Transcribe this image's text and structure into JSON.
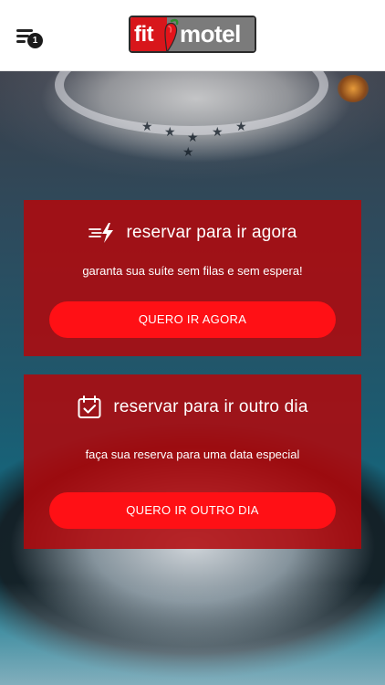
{
  "header": {
    "menu_badge_count": "1",
    "logo": {
      "left_text": "fit",
      "right_text": "motel"
    }
  },
  "cards": [
    {
      "icon": "fast-lightning-icon",
      "title": "reservar para ir agora",
      "subtitle": "garanta sua suíte sem filas e sem espera!",
      "button_label": "QUERO IR AGORA"
    },
    {
      "icon": "calendar-check-icon",
      "title": "reservar para ir outro dia",
      "subtitle": "faça sua reserva para uma data especial",
      "button_label": "QUERO IR OUTRO DIA"
    }
  ],
  "colors": {
    "brand_red": "#d8161b",
    "card_bg": "#b2080c",
    "button_red": "#ff1015"
  }
}
